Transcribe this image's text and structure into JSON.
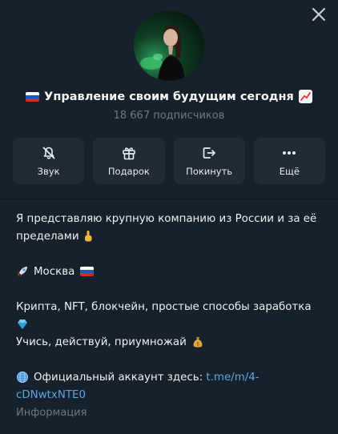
{
  "channel": {
    "title": "Управление своим будущим сегодня",
    "subscribers": "18 667 подписчиков"
  },
  "actions": [
    {
      "label": "Звук",
      "icon": "bell-muted-icon"
    },
    {
      "label": "Подарок",
      "icon": "gift-icon"
    },
    {
      "label": "Покинуть",
      "icon": "leave-icon"
    },
    {
      "label": "Ещё",
      "icon": "more-icon"
    }
  ],
  "description": {
    "line1": "Я представляю крупную компанию из России и за её пределами",
    "line2": "Москва",
    "line3": "Крипта, NFT, блокчейн, простые способы заработка",
    "line4": "Учись, действуй, приумножай",
    "line5_prefix": "Официальный аккаунт здесь: ",
    "link": "t.me/m/4-cDNwtxNTE0"
  },
  "info_label": "Информация",
  "colors": {
    "background": "#17212b",
    "button_bg": "#202b36",
    "muted_text": "#6d7883",
    "link": "#5aa7e5"
  }
}
